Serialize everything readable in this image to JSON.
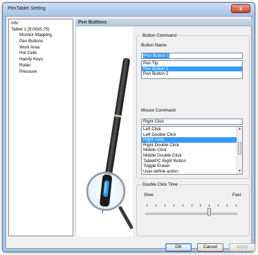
{
  "window": {
    "title": "PenTablet Setting",
    "close_label": "x"
  },
  "tree": {
    "items": [
      {
        "label": "Info",
        "level": 1
      },
      {
        "label": "Tablet 1 (9.00x5.75)",
        "level": 1
      },
      {
        "label": "Monitor Mapping",
        "level": 2
      },
      {
        "label": "Pen Buttons",
        "level": 2
      },
      {
        "label": "Work Area",
        "level": 2
      },
      {
        "label": "Hot Cells",
        "level": 2
      },
      {
        "label": "Handy Keys",
        "level": 2
      },
      {
        "label": "Roller",
        "level": 2
      },
      {
        "label": "Pressure",
        "level": 2
      }
    ]
  },
  "header": {
    "title": "Pen Buttons"
  },
  "button_command": {
    "group_label": "Button Command",
    "name_label": "Button Name",
    "name_value": "Pen Button 1",
    "options": [
      "Pen Tip",
      "Pen Button 1",
      "Pen Button 2"
    ],
    "selected_index": 1
  },
  "mouse_command": {
    "label": "Mouse Command",
    "value": "Right Click",
    "options": [
      "Left Click",
      "Left Double Click",
      "Right Click",
      "Right Double Click",
      "Middle Click",
      "Middle Double Click",
      "TabletPC Right Button",
      "Toggle Eraser",
      "User define action"
    ],
    "selected_index": 2
  },
  "double_click": {
    "group_label": "Double Click Time",
    "slow_label": "Slow",
    "fast_label": "Fast",
    "tick_count": 11,
    "value": 0.7
  },
  "buttons": {
    "ok": "OK",
    "cancel": "Cancel",
    "apply": "Apply"
  },
  "colors": {
    "selection": "#3399ff",
    "pen_accent": "#2a9df4",
    "header_bg": "#c9d7e8"
  },
  "icons": {
    "close": "close-icon",
    "scroll_up": "scroll-up-icon",
    "scroll_down": "scroll-down-icon"
  }
}
